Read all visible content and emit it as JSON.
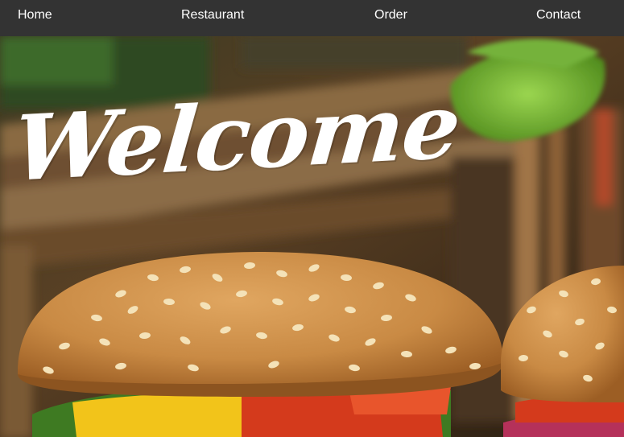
{
  "nav": {
    "items": [
      {
        "label": "Home"
      },
      {
        "label": "Restaurant"
      },
      {
        "label": "Order"
      },
      {
        "label": "Contact"
      }
    ]
  },
  "hero": {
    "title": "Welcome"
  },
  "colors": {
    "nav_background": "#333333",
    "nav_text": "#ffffff",
    "title_text": "#ffffff"
  }
}
